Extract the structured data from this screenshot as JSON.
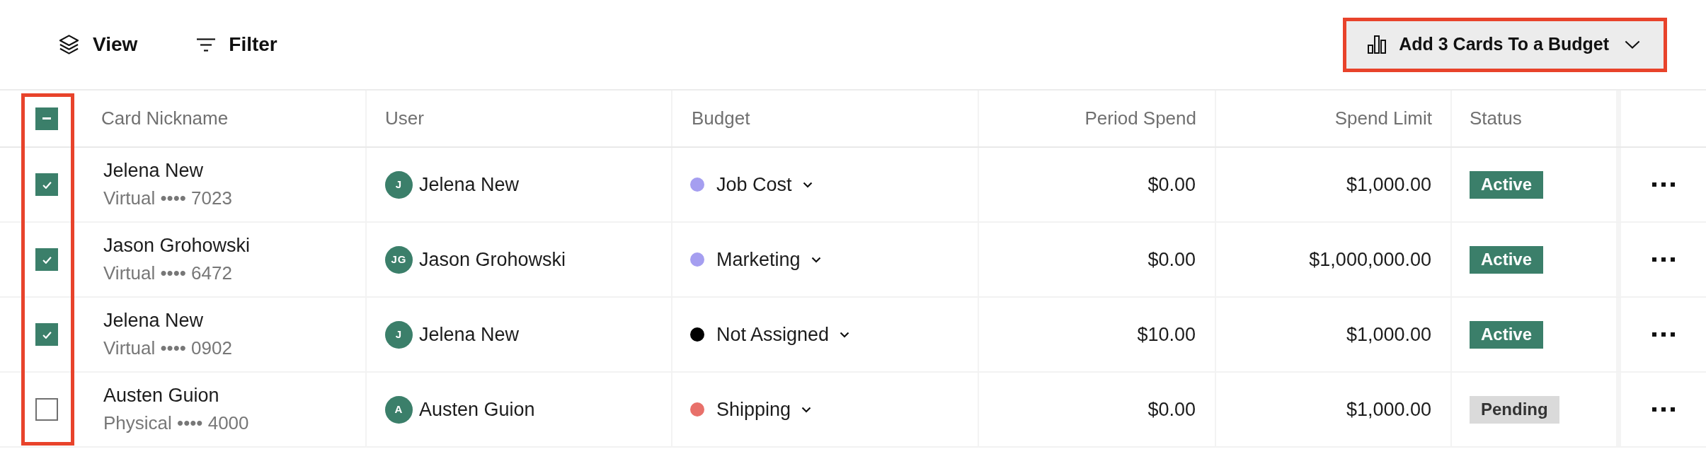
{
  "toolbar": {
    "items": [
      {
        "kind": "view",
        "label": "View"
      },
      {
        "kind": "filter",
        "label": "Filter"
      }
    ],
    "bulk_action": {
      "label": "Add 3 Cards To a Budget",
      "highlighted": true
    }
  },
  "table": {
    "select_all": {
      "indeterminate": true
    },
    "select_column_highlighted": true,
    "columns": [
      "Card Nickname",
      "User",
      "Budget",
      "Period Spend",
      "Spend Limit",
      "Status"
    ],
    "rows": [
      {
        "checked": true,
        "nickname": "Jelena New",
        "card": "Virtual •••• 7023",
        "user": {
          "initials": "J",
          "name": "Jelena New"
        },
        "budget": {
          "name": "Job Cost",
          "color": "#a59ef0"
        },
        "period_spend": "$0.00",
        "spend_limit": "$1,000.00",
        "status": {
          "kind": "active",
          "label": "Active"
        }
      },
      {
        "checked": true,
        "nickname": "Jason Grohowski",
        "card": "Virtual •••• 6472",
        "user": {
          "initials": "JG",
          "name": "Jason Grohowski"
        },
        "budget": {
          "name": "Marketing",
          "color": "#a59ef0"
        },
        "period_spend": "$0.00",
        "spend_limit": "$1,000,000.00",
        "status": {
          "kind": "active",
          "label": "Active"
        }
      },
      {
        "checked": true,
        "nickname": "Jelena New",
        "card": "Virtual •••• 0902",
        "user": {
          "initials": "J",
          "name": "Jelena New"
        },
        "budget": {
          "name": "Not Assigned",
          "color": "#000000"
        },
        "period_spend": "$10.00",
        "spend_limit": "$1,000.00",
        "status": {
          "kind": "active",
          "label": "Active"
        }
      },
      {
        "checked": false,
        "nickname": "Austen Guion",
        "card": "Physical •••• 4000",
        "user": {
          "initials": "A",
          "name": "Austen Guion"
        },
        "budget": {
          "name": "Shipping",
          "color": "#e8706a"
        },
        "period_spend": "$0.00",
        "spend_limit": "$1,000.00",
        "status": {
          "kind": "pending",
          "label": "Pending"
        }
      }
    ]
  }
}
